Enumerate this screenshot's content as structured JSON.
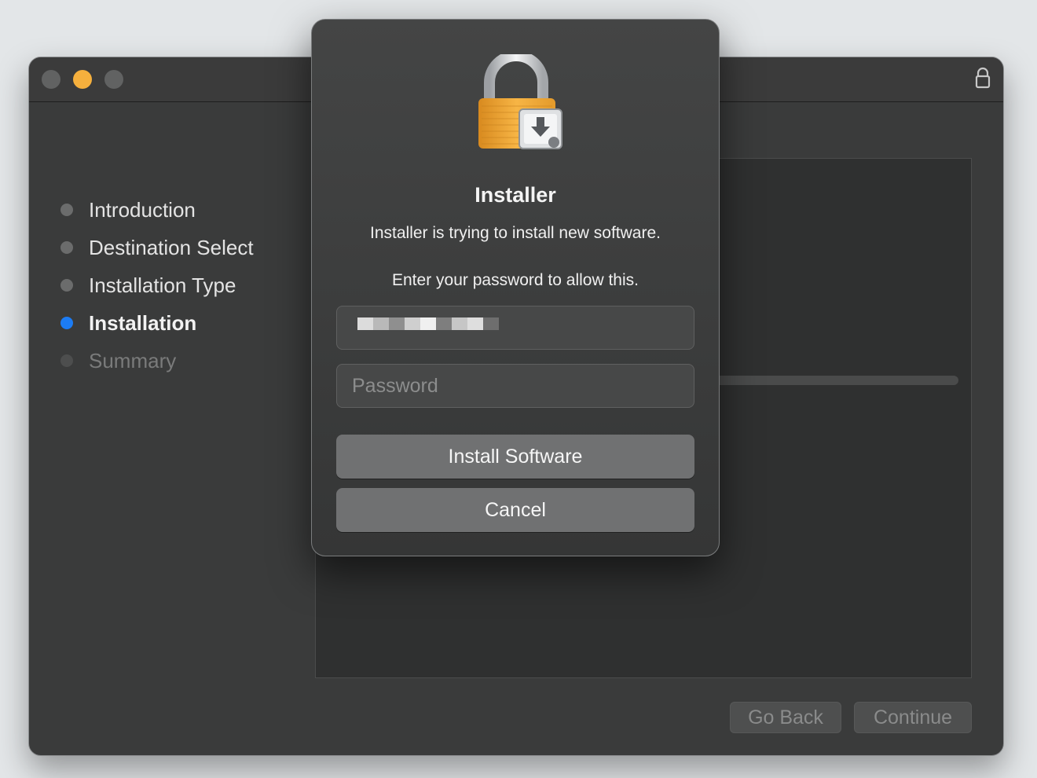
{
  "window": {
    "steps": [
      {
        "label": "Introduction",
        "state": "done"
      },
      {
        "label": "Destination Select",
        "state": "done"
      },
      {
        "label": "Installation Type",
        "state": "done"
      },
      {
        "label": "Installation",
        "state": "active"
      },
      {
        "label": "Summary",
        "state": "pending"
      }
    ],
    "footer": {
      "go_back_label": "Go Back",
      "continue_label": "Continue"
    }
  },
  "dialog": {
    "title": "Installer",
    "message": "Installer is trying to install new software.",
    "prompt": "Enter your password to allow this.",
    "username_value": "[redacted]",
    "password_placeholder": "Password",
    "install_label": "Install Software",
    "cancel_label": "Cancel"
  },
  "colors": {
    "active_step": "#1c7cf4",
    "minimize_button": "#f6b03d",
    "lock_body": "#f0a93a"
  },
  "icons": {
    "title_lock": "lock-icon",
    "dialog_image": "installer-lock-icon"
  }
}
